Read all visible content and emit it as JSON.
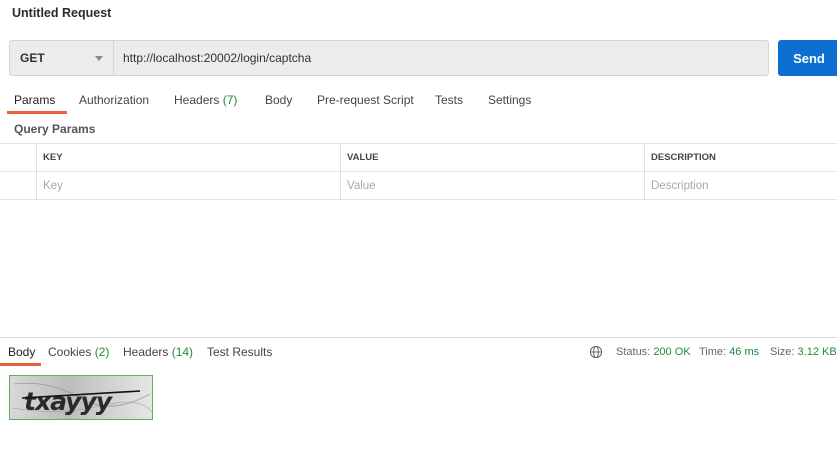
{
  "request": {
    "title": "Untitled Request",
    "method": "GET",
    "url": "http://localhost:20002/login/captcha",
    "send_label": "Send"
  },
  "request_tabs": [
    {
      "label": "Params",
      "count": "",
      "active": true
    },
    {
      "label": "Authorization",
      "count": ""
    },
    {
      "label": "Headers",
      "count": "(7)"
    },
    {
      "label": "Body",
      "count": ""
    },
    {
      "label": "Pre-request Script",
      "count": ""
    },
    {
      "label": "Tests",
      "count": ""
    },
    {
      "label": "Settings",
      "count": ""
    }
  ],
  "query_params": {
    "title": "Query Params",
    "columns": [
      "KEY",
      "VALUE",
      "DESCRIPTION"
    ],
    "placeholders": [
      "Key",
      "Value",
      "Description"
    ]
  },
  "response_tabs": [
    {
      "label": "Body",
      "count": "",
      "active": true
    },
    {
      "label": "Cookies",
      "count": "(2)"
    },
    {
      "label": "Headers",
      "count": "(14)"
    },
    {
      "label": "Test Results",
      "count": ""
    }
  ],
  "response_status": {
    "status_label": "Status:",
    "status_value": "200 OK",
    "time_label": "Time:",
    "time_value": "46 ms",
    "size_label": "Size:",
    "size_value": "3.12 KB"
  },
  "captcha": {
    "text": "txayyy"
  },
  "colors": {
    "accent": "#e8613c",
    "send": "#0d6fd1",
    "ok": "#21893b"
  },
  "icons": {
    "method_dropdown": "chevron-down-icon",
    "network": "globe-icon"
  }
}
